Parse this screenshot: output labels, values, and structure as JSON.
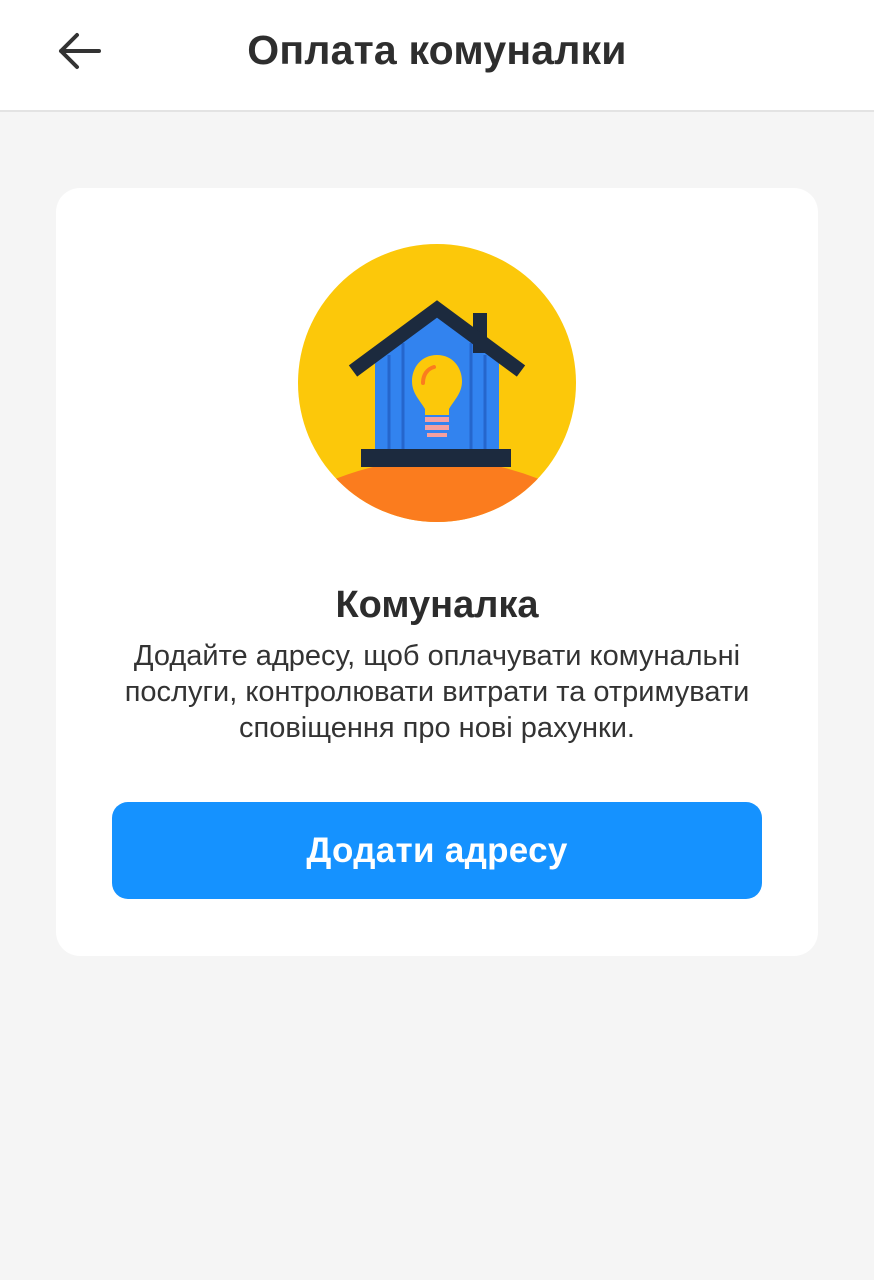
{
  "header": {
    "back_icon": "arrow-left-icon",
    "title": "Оплата комуналки"
  },
  "card": {
    "illustration_icon": "house-lightbulb-icon",
    "title": "Комуналка",
    "description": "Додайте адресу, щоб оплачувати комунальні послуги, контролювати витрати та отримувати сповіщення про нові рахунки.",
    "button_label": "Додати адресу"
  },
  "colors": {
    "background": "#f5f5f5",
    "card": "#ffffff",
    "accent": "#1592ff",
    "circle": "#fcc80a",
    "ground": "#fb7c1e",
    "house": "#3283ef",
    "roof": "#1c2a3e",
    "bulb": "#fcc80a"
  }
}
